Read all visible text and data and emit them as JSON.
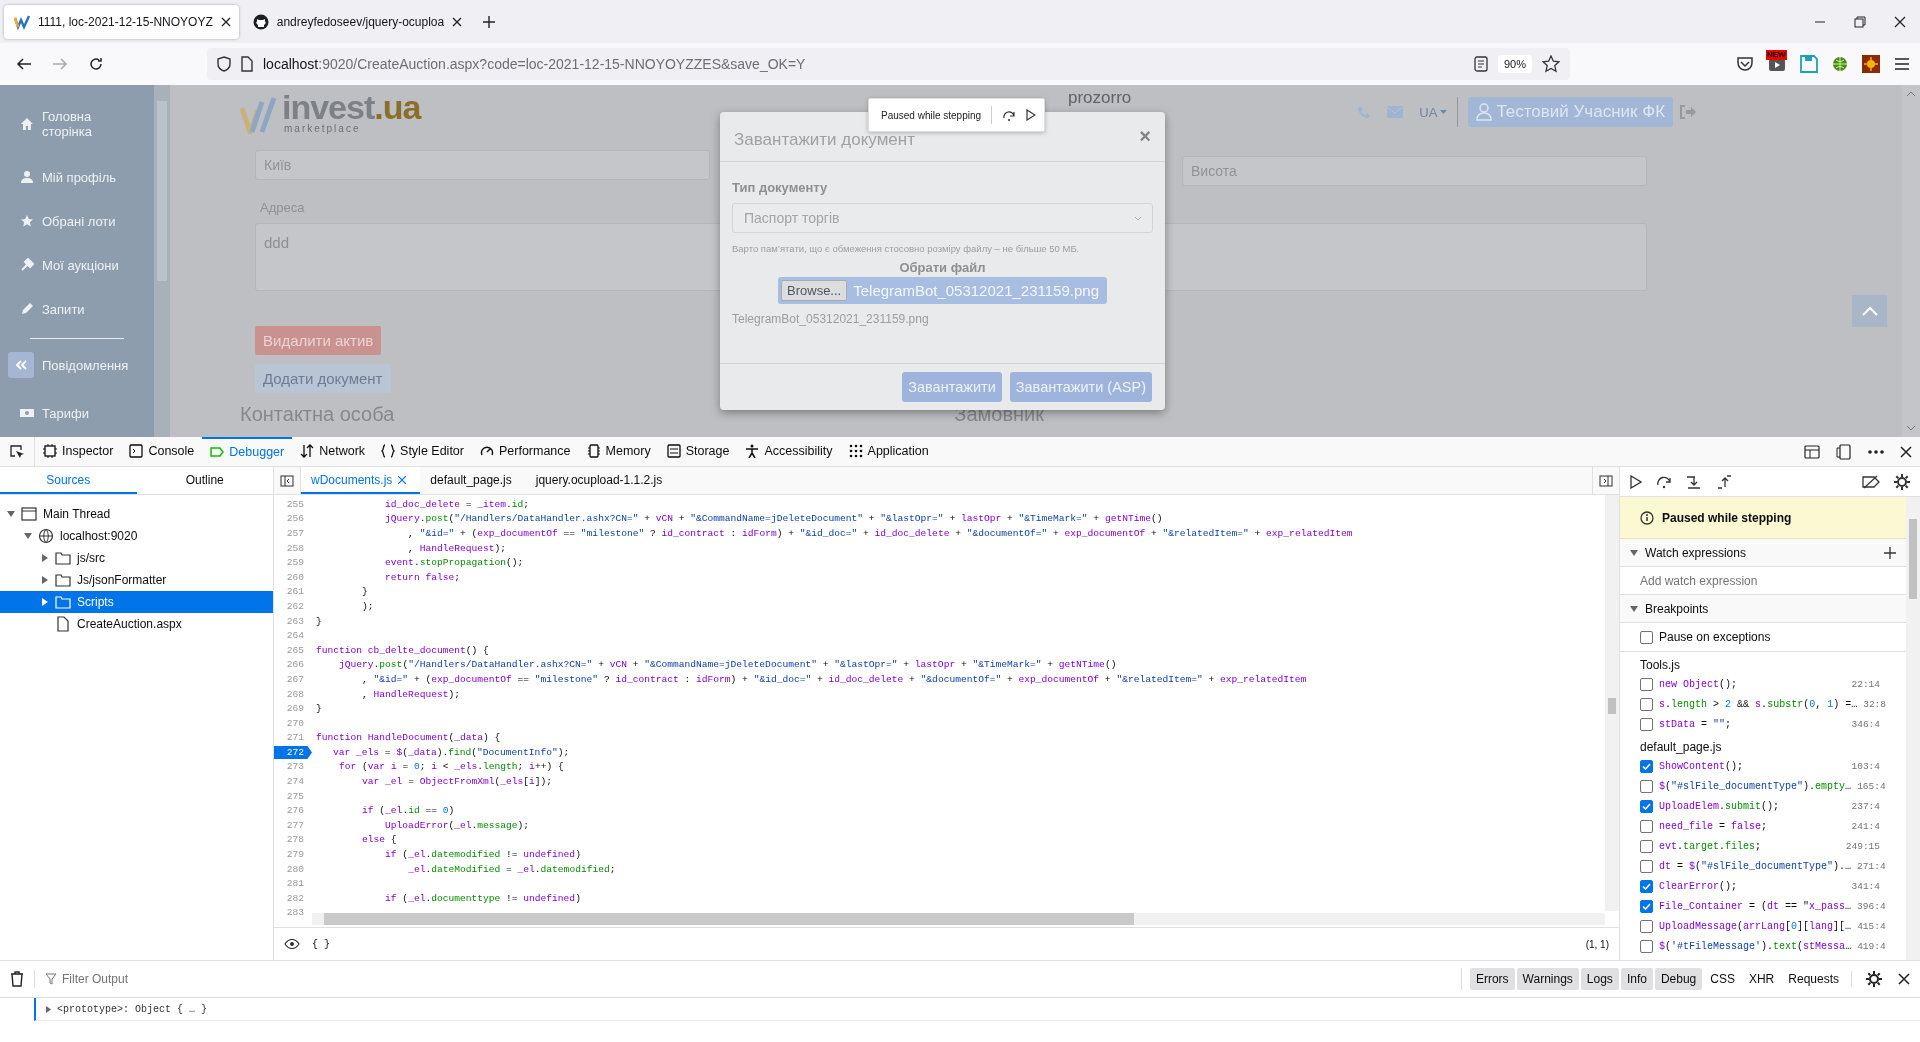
{
  "browser": {
    "tabs": [
      {
        "title": "1111, loc-2021-12-15-NNOYOYZ",
        "selected": true
      },
      {
        "title": "andreyfedoseev/jquery-ocuploa",
        "selected": false
      }
    ],
    "url_host": "localhost",
    "url_rest": ":9020/CreateAuction.aspx?code=loc-2021-12-15-NNOYOYZZES&save_OK=Y",
    "zoom": "90%",
    "extension_badge": "NEW"
  },
  "page": {
    "sidebar": [
      {
        "label": "Головна сторінка",
        "kind": "link"
      },
      {
        "label": "Мій профіль",
        "kind": "link"
      },
      {
        "label": "Обрані лоти",
        "kind": "link"
      },
      {
        "label": "Мої аукціони",
        "kind": "link"
      },
      {
        "label": "Запити",
        "kind": "link"
      },
      {
        "label": "Повідомлення",
        "kind": "toggle"
      },
      {
        "label": "Тарифи",
        "kind": "link"
      }
    ],
    "logo": {
      "name": "invest",
      "domain": ".ua",
      "tagline": "marketplace"
    },
    "partner": "prozorro",
    "language": "UA",
    "user": "Тестовий Учасник ФК",
    "city_value": "Київ",
    "height_placeholder": "Висота",
    "address_label": "Адреса",
    "address_value": "ddd",
    "buttons": [
      "Видалити актив",
      "Додати документ"
    ],
    "headings": [
      "Контактна особа",
      "Замовник"
    ]
  },
  "modal": {
    "title": "Завантажити документ",
    "close": "×",
    "doc_type_label": "Тип документу",
    "doc_type_value": "Паспорт торгів",
    "note": "Варто пам’ятати, що є обмеження стосовно розміру файлу – не більше 50 МБ.",
    "choose_label": "Обрати файл",
    "browse": "Browse...",
    "file_button": "TelegramBot_05312021_231159.png",
    "file_name": "TelegramBot_05312021_231159.png",
    "buttons": [
      "Завантажити",
      "Завантажити (ASP)"
    ]
  },
  "paused_overlay": {
    "text": "Paused while stepping"
  },
  "devtools": {
    "tabs": [
      {
        "label": "Inspector",
        "selected": false
      },
      {
        "label": "Console",
        "selected": false
      },
      {
        "label": "Debugger",
        "selected": true
      },
      {
        "label": "Network",
        "selected": false
      },
      {
        "label": "Style Editor",
        "selected": false
      },
      {
        "label": "Performance",
        "selected": false
      },
      {
        "label": "Memory",
        "selected": false
      },
      {
        "label": "Storage",
        "selected": false
      },
      {
        "label": "Accessibility",
        "selected": false
      },
      {
        "label": "Application",
        "selected": false
      }
    ],
    "source_tabs": [
      {
        "label": "Sources",
        "selected": true
      },
      {
        "label": "Outline",
        "selected": false
      }
    ],
    "tree": [
      {
        "label": "Main Thread",
        "kind": "thread",
        "expanded": true,
        "selected": false,
        "children": [
          {
            "label": "localhost:9020",
            "kind": "host",
            "expanded": true,
            "selected": false,
            "children": [
              {
                "label": "js/src",
                "kind": "folder",
                "expanded": false,
                "selected": false
              },
              {
                "label": "Js/jsonFormatter",
                "kind": "folder",
                "expanded": false,
                "selected": false
              },
              {
                "label": "Scripts",
                "kind": "folder",
                "expanded": false,
                "selected": true
              },
              {
                "label": "CreateAuction.aspx",
                "kind": "file",
                "selected": false
              }
            ]
          }
        ]
      }
    ],
    "editor_tabs": [
      {
        "label": "wDocuments.js",
        "selected": true
      },
      {
        "label": "default_page.js",
        "selected": false
      },
      {
        "label": "jquery.ocupload-1.1.2.js",
        "selected": false
      }
    ],
    "lines": [
      {
        "number": "255",
        "text": "            id_doc_delete = _item.id;",
        "paused": false
      },
      {
        "number": "256",
        "text": "            jQuery.post(\"/Handlers/DataHandler.ashx?CN=\" + vCN + \"&CommandName=jDeleteDocument\" + \"&lastOpr=\" + lastOpr + \"&TimeMark=\" + getNTime()",
        "paused": false
      },
      {
        "number": "257",
        "text": "                , \"&id=\" + (exp_documentOf == \"milestone\" ? id_contract : idForm) + \"&id_doc=\" + id_doc_delete + \"&documentOf=\" + exp_documentOf + \"&relatedItem=\" + exp_relatedItem",
        "paused": false
      },
      {
        "number": "258",
        "text": "                , HandleRequest);",
        "paused": false
      },
      {
        "number": "259",
        "text": "            event.stopPropagation();",
        "paused": false
      },
      {
        "number": "260",
        "text": "            return false;",
        "paused": false
      },
      {
        "number": "261",
        "text": "        }",
        "paused": false
      },
      {
        "number": "262",
        "text": "        );",
        "paused": false
      },
      {
        "number": "263",
        "text": "}",
        "paused": false
      },
      {
        "number": "264",
        "paused": false
      },
      {
        "number": "265",
        "text": "function cb_delte_document() {",
        "paused": false
      },
      {
        "number": "266",
        "text": "    jQuery.post(\"/Handlers/DataHandler.ashx?CN=\" + vCN + \"&CommandName=jDeleteDocument\" + \"&lastOpr=\" + lastOpr + \"&TimeMark=\" + getNTime()",
        "paused": false
      },
      {
        "number": "267",
        "text": "        , \"&id=\" + (exp_documentOf == \"milestone\" ? id_contract : idForm) + \"&id_doc=\" + id_doc_delete + \"&documentOf=\" + exp_documentOf + \"&relatedItem=\" + exp_relatedItem",
        "paused": false
      },
      {
        "number": "268",
        "text": "        , HandleRequest);",
        "paused": false
      },
      {
        "number": "269",
        "text": "}",
        "paused": false
      },
      {
        "number": "270",
        "paused": false
      },
      {
        "number": "271",
        "text": "function HandleDocument(_data) {",
        "paused": false
      },
      {
        "number": "272",
        "text": "    var _els = $(_data).find(\"DocumentInfo\");",
        "paused": true
      },
      {
        "number": "273",
        "text": "    for (var i = 0; i < _els.length; i++) {",
        "paused": false
      },
      {
        "number": "274",
        "text": "        var _el = ObjectFromXml(_els[i]);",
        "paused": false
      },
      {
        "number": "275",
        "paused": false
      },
      {
        "number": "276",
        "text": "        if (_el.id == 0)",
        "paused": false
      },
      {
        "number": "277",
        "text": "            UploadError(_el.message);",
        "paused": false
      },
      {
        "number": "278",
        "text": "        else {",
        "paused": false
      },
      {
        "number": "279",
        "text": "            if (_el.datemodified != undefined)",
        "paused": false
      },
      {
        "number": "280",
        "text": "                _el.dateModified = _el.datemodified;",
        "paused": false
      },
      {
        "number": "281",
        "paused": false
      },
      {
        "number": "282",
        "text": "            if (_el.documenttype != undefined)",
        "paused": false
      },
      {
        "number": "283",
        "paused": false
      }
    ],
    "watch_bar": "{ }",
    "cursor": "(1, 1)",
    "side": {
      "status": "Paused while stepping",
      "watch_title": "Watch expressions",
      "watch_placeholder": "Add watch expression",
      "breakpoints_title": "Breakpoints",
      "pause_on_exceptions": {
        "label": "Pause on exceptions",
        "checked": false
      },
      "groups": [
        {
          "file": "Tools.js",
          "items": [
            {
              "code": "new Object();",
              "location": "22:14",
              "checked": false
            },
            {
              "code": "s.length > 2 && s.substr(0, 1) =…",
              "location": "32:8",
              "checked": false
            },
            {
              "code": "stData = \"\";",
              "location": "346:4",
              "checked": false
            }
          ]
        },
        {
          "file": "default_page.js",
          "items": [
            {
              "code": "ShowContent();",
              "location": "103:4",
              "checked": true
            },
            {
              "code": "$(\"#slFile_documentType\").empty…",
              "location": "165:4",
              "checked": false
            },
            {
              "code": "UploadElem.submit();",
              "location": "237:4",
              "checked": true
            },
            {
              "code": "need_file = false;",
              "location": "241:4",
              "checked": false
            },
            {
              "code": "evt.target.files;",
              "location": "249:15",
              "checked": false
            },
            {
              "code": "dt = $(\"#slFile_documentType\").…",
              "location": "271:4",
              "checked": false
            },
            {
              "code": "ClearError();",
              "location": "341:4",
              "checked": true
            },
            {
              "code": "File_Container = (dt == \"x_pass…",
              "location": "396:4",
              "checked": true
            },
            {
              "code": "UploadMessage(arrLang[0][lang][…",
              "location": "415:4",
              "checked": false
            },
            {
              "code": "$('#tFileMessage').text(stMessa…",
              "location": "419:4",
              "checked": false
            }
          ]
        }
      ]
    },
    "console": {
      "filter_placeholder": "Filter Output",
      "filters": [
        {
          "label": "Errors",
          "selected": true
        },
        {
          "label": "Warnings",
          "selected": true
        },
        {
          "label": "Logs",
          "selected": true
        },
        {
          "label": "Info",
          "selected": true
        },
        {
          "label": "Debug",
          "selected": true
        },
        {
          "label": "CSS",
          "selected": false
        },
        {
          "label": "XHR",
          "selected": false
        },
        {
          "label": "Requests",
          "selected": false
        }
      ],
      "output": "<prototype>: Object { … }"
    }
  }
}
